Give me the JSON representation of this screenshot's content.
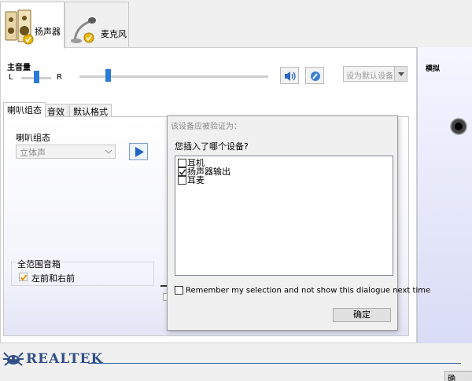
{
  "tabs": [
    {
      "label": "扬声器",
      "active": true,
      "icon": "speaker-icon"
    },
    {
      "label": "麦克风",
      "active": false,
      "icon": "microphone-icon"
    }
  ],
  "main_volume": {
    "label": "主音量",
    "left_label": "L",
    "right_label": "R",
    "balance_level": 0.5,
    "volume_level": 0.15
  },
  "set_default_button": {
    "label": "设为默认设备"
  },
  "sub_tabs": [
    {
      "label": "喇叭组态",
      "active": true
    },
    {
      "label": "音效",
      "active": false
    },
    {
      "label": "默认格式",
      "active": false
    }
  ],
  "speaker_config": {
    "group_label": "喇叭组态",
    "selected": "立体声"
  },
  "fullrange": {
    "group_label": "全范围音箱",
    "option_label": "左前和右前",
    "checked": true
  },
  "right_panel": {
    "label": "模拟"
  },
  "dialog": {
    "title": "该设备应被验证为：",
    "prompt": "您插入了哪个设备?",
    "options": [
      {
        "label": "耳机",
        "checked": false
      },
      {
        "label": "扬声器输出",
        "checked": true
      },
      {
        "label": "耳麦",
        "checked": false
      }
    ],
    "remember_label": "Remember my selection and not show this dialogue next time",
    "ok_label": "确定"
  },
  "brand": {
    "name": "REALTEK",
    "color": "#324f88"
  },
  "bottom_button": {
    "label": "确"
  },
  "colors": {
    "accent": "#2a7bd8"
  }
}
